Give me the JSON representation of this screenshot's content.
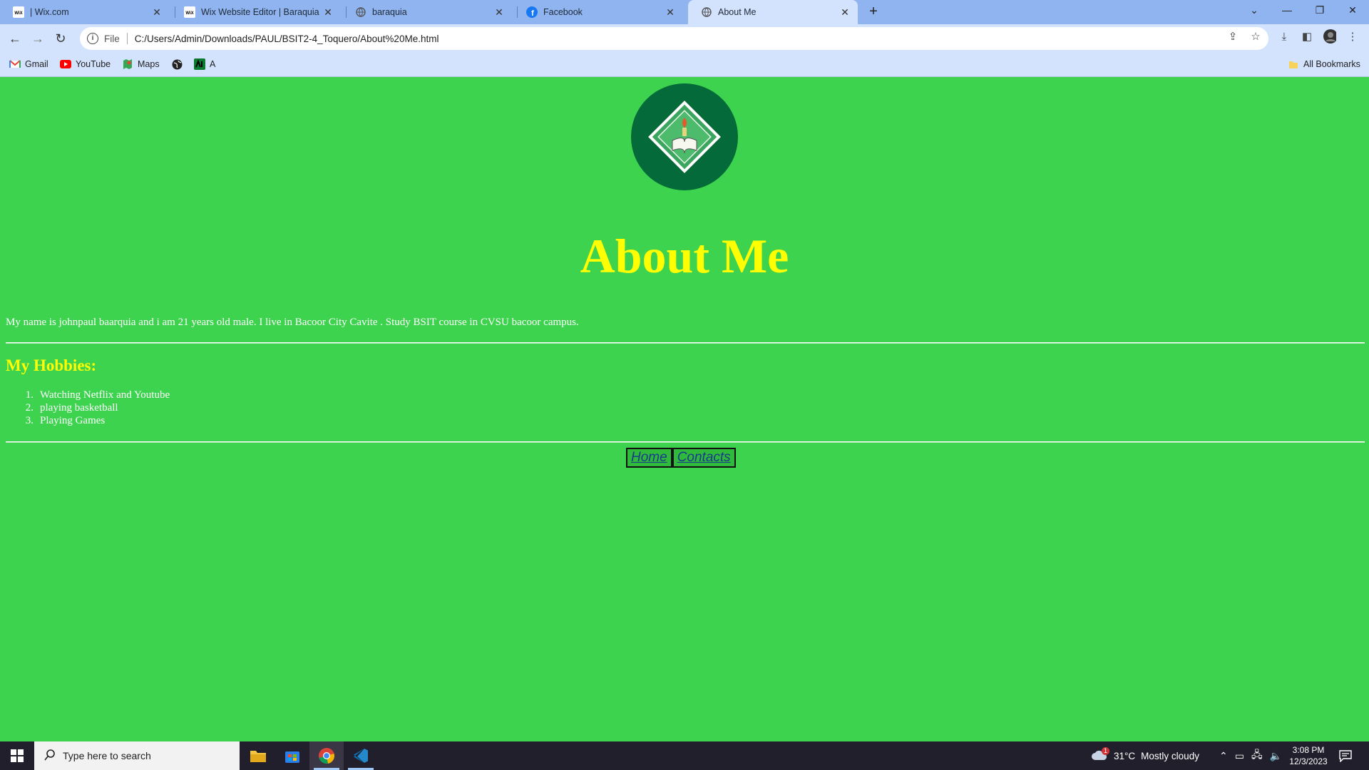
{
  "browser": {
    "tabs": [
      {
        "title": "| Wix.com",
        "icon": "wix-icon"
      },
      {
        "title": "Wix Website Editor | Baraquia",
        "icon": "wix-icon"
      },
      {
        "title": "baraquia",
        "icon": "globe-icon"
      },
      {
        "title": "Facebook",
        "icon": "facebook-icon"
      },
      {
        "title": "About Me",
        "icon": "globe-icon",
        "active": true
      }
    ],
    "address": {
      "scheme": "File",
      "url": "C:/Users/Admin/Downloads/PAUL/BSIT2-4_Toquero/About%20Me.html"
    },
    "bookmarks": [
      {
        "label": "Gmail",
        "icon": "gmail-icon"
      },
      {
        "label": "YouTube",
        "icon": "youtube-icon"
      },
      {
        "label": "Maps",
        "icon": "maps-icon"
      },
      {
        "label": "",
        "icon": "globe-icon"
      },
      {
        "label": "A",
        "icon": "green-app-icon"
      }
    ],
    "all_bookmarks": "All Bookmarks"
  },
  "page": {
    "title": "About Me",
    "intro": "My name is johnpaul baarquia and i am 21 years old male. I live in Bacoor City Cavite . Study BSIT course in CVSU bacoor campus.",
    "hobbies_heading": "My Hobbies:",
    "hobbies": [
      "Watching Netflix and Youtube",
      "playing basketball",
      "Playing Games"
    ],
    "nav": {
      "home": "Home",
      "contacts": "Contacts"
    },
    "colors": {
      "background": "#3dd34f",
      "heading": "#ffff00",
      "logo": "#046a3a"
    }
  },
  "taskbar": {
    "search_placeholder": "Type here to search",
    "weather": {
      "temp": "31°C",
      "condition": "Mostly cloudy",
      "badge": "1"
    },
    "time": "3:08 PM",
    "date": "12/3/2023"
  }
}
